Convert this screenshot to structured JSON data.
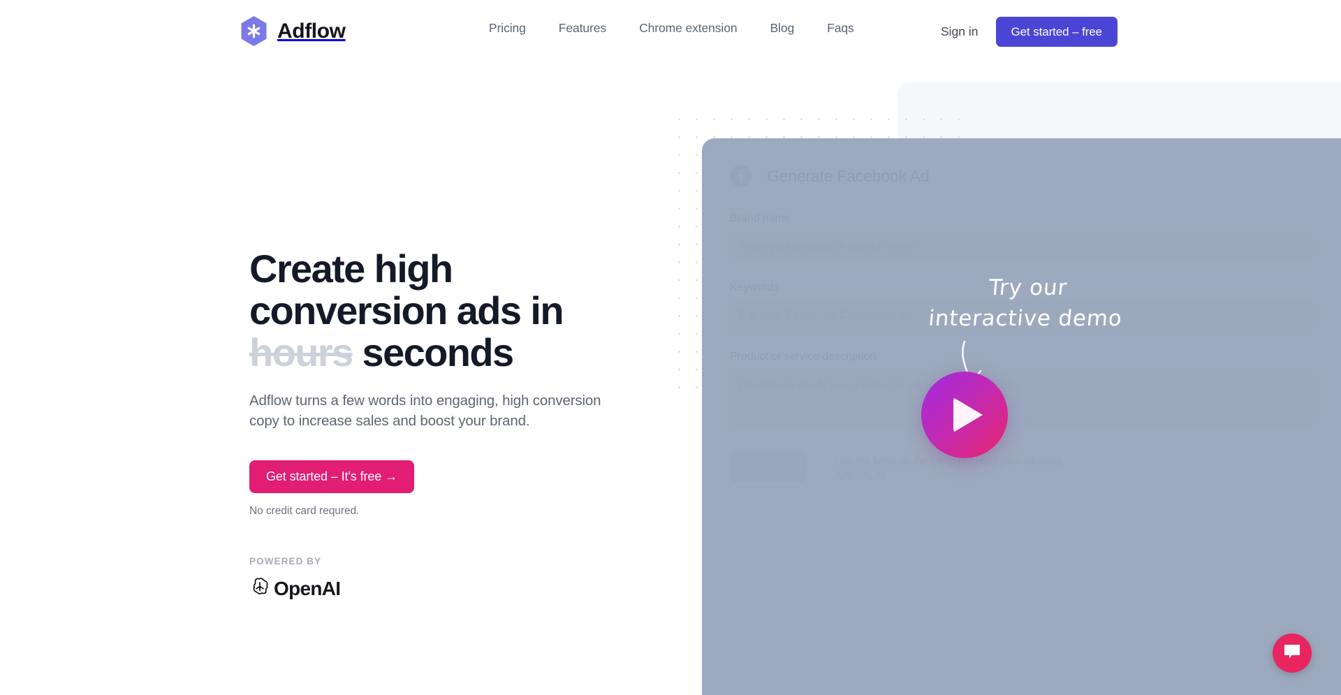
{
  "header": {
    "brand": "Adflow",
    "nav": [
      {
        "label": "Pricing"
      },
      {
        "label": "Features"
      },
      {
        "label": "Chrome extension"
      },
      {
        "label": "Blog"
      },
      {
        "label": "Faqs"
      }
    ],
    "sign_in": "Sign in",
    "get_started": "Get started – free",
    "accent_color": "#4b45d6"
  },
  "hero": {
    "headline_part1": "Create high conversion ads in",
    "headline_struck": "hours",
    "headline_part2": "seconds",
    "subtitle": "Adflow turns a few words into engaging, high conversion copy to increase sales and boost your brand.",
    "cta_label": "Get started – It's free →",
    "cta_color": "#e11d74",
    "no_credit_card": "No credit card requred.",
    "powered_by_label": "POWERED BY",
    "powered_by_name": "OpenAI"
  },
  "demo_panel": {
    "title": "Generate Facebook Ad",
    "fields": [
      {
        "label": "Brand name",
        "placeholder": "Insert your product or service name",
        "value": ""
      },
      {
        "label": "Keywords",
        "placeholder": "E.g. Ads, Facebook Campaigns",
        "value": ""
      },
      {
        "label": "Product or service description",
        "placeholder": "Describe to the AI your product or service's main features",
        "value": ""
      }
    ],
    "generate_label": "Generate",
    "hint": "Use the fields on the left to generate your ad using Adflow's AI"
  },
  "overlay": {
    "demo_line1": "Try our",
    "demo_line2": "interactive demo",
    "play_label": "Play demo video"
  },
  "chat": {
    "label": "Open chat"
  }
}
